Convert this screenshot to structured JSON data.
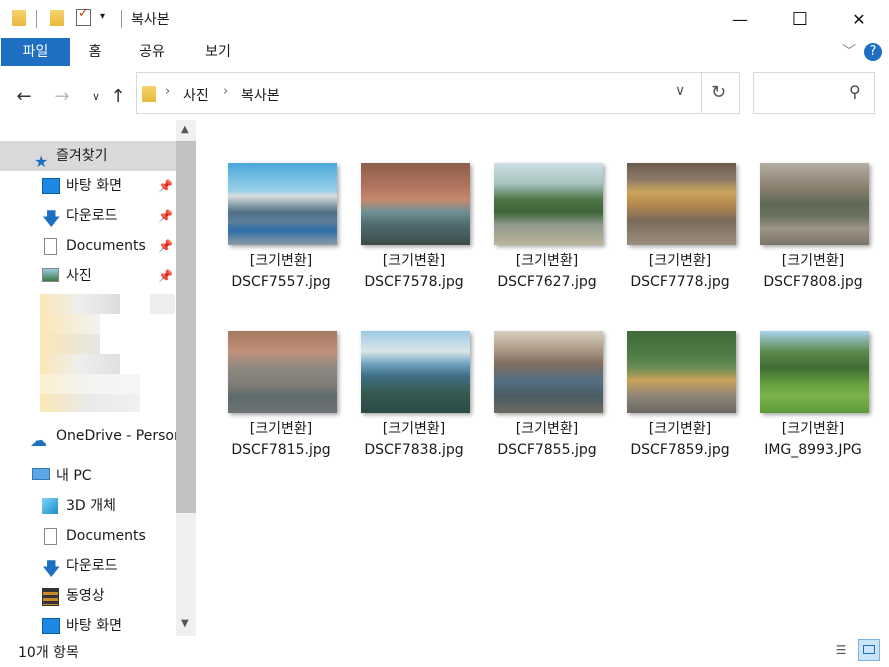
{
  "window": {
    "title": "복사본",
    "controls": {
      "minimize": "—",
      "maximize": "☐",
      "close": "✕"
    }
  },
  "ribbon": {
    "tabs": [
      {
        "label": "파일",
        "active": true
      },
      {
        "label": "홈"
      },
      {
        "label": "공유"
      },
      {
        "label": "보기"
      }
    ]
  },
  "address": {
    "path": [
      "사진",
      "복사본"
    ],
    "search_placeholder": ""
  },
  "sidebar": {
    "quick_access": "즐겨찾기",
    "pinned": [
      "바탕 화면",
      "다운로드",
      "Documents",
      "사진"
    ],
    "onedrive": "OneDrive - Person",
    "this_pc": "내 PC",
    "pc_items": [
      "3D 개체",
      "Documents",
      "다운로드",
      "동영상",
      "바탕 화면"
    ]
  },
  "files": [
    {
      "line1": "[크기변환]",
      "line2": "DSCF7557.jpg"
    },
    {
      "line1": "[크기변환]",
      "line2": "DSCF7578.jpg"
    },
    {
      "line1": "[크기변환]",
      "line2": "DSCF7627.jpg"
    },
    {
      "line1": "[크기변환]",
      "line2": "DSCF7778.jpg"
    },
    {
      "line1": "[크기변환]",
      "line2": "DSCF7808.jpg"
    },
    {
      "line1": "[크기변환]",
      "line2": "DSCF7815.jpg"
    },
    {
      "line1": "[크기변환]",
      "line2": "DSCF7838.jpg"
    },
    {
      "line1": "[크기변환]",
      "line2": "DSCF7855.jpg"
    },
    {
      "line1": "[크기변환]",
      "line2": "DSCF7859.jpg"
    },
    {
      "line1": "[크기변환]",
      "line2": "IMG_8993.JPG"
    }
  ],
  "status": {
    "count": "10개 항목"
  },
  "colors": {
    "accent": "#1e6fc1",
    "selected": "#cce4f7"
  }
}
